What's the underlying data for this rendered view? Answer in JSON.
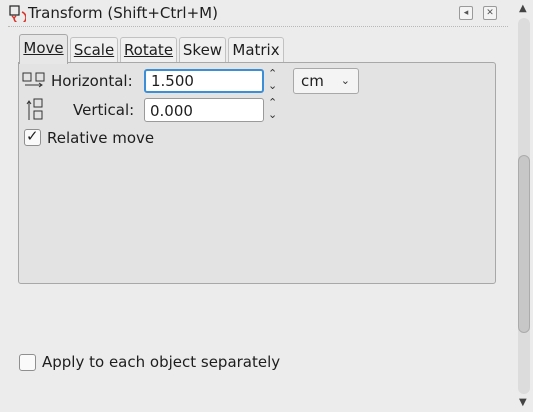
{
  "dialog": {
    "title": "Transform (Shift+Ctrl+M)",
    "title_icon": "transform-icon",
    "controls": [
      "panel-collapse-icon",
      "close-icon"
    ]
  },
  "tabs": [
    {
      "label": "Move",
      "active": true
    },
    {
      "label": "Scale",
      "active": false
    },
    {
      "label": "Rotate",
      "active": false
    },
    {
      "label": "Skew",
      "active": false
    },
    {
      "label": "Matrix",
      "active": false
    }
  ],
  "move": {
    "horizontal_label": "Horizontal:",
    "horizontal_value": "1.500",
    "vertical_label": "Vertical:",
    "vertical_value": "0.000",
    "unit": "cm",
    "relative_move_label": "Relative move",
    "relative_move_checked": true
  },
  "apply_each": {
    "label": "Apply to each object separately",
    "checked": false
  },
  "colors": {
    "focus_border": "#3c8fd6",
    "transform_icon_accent": "#d9342b"
  }
}
